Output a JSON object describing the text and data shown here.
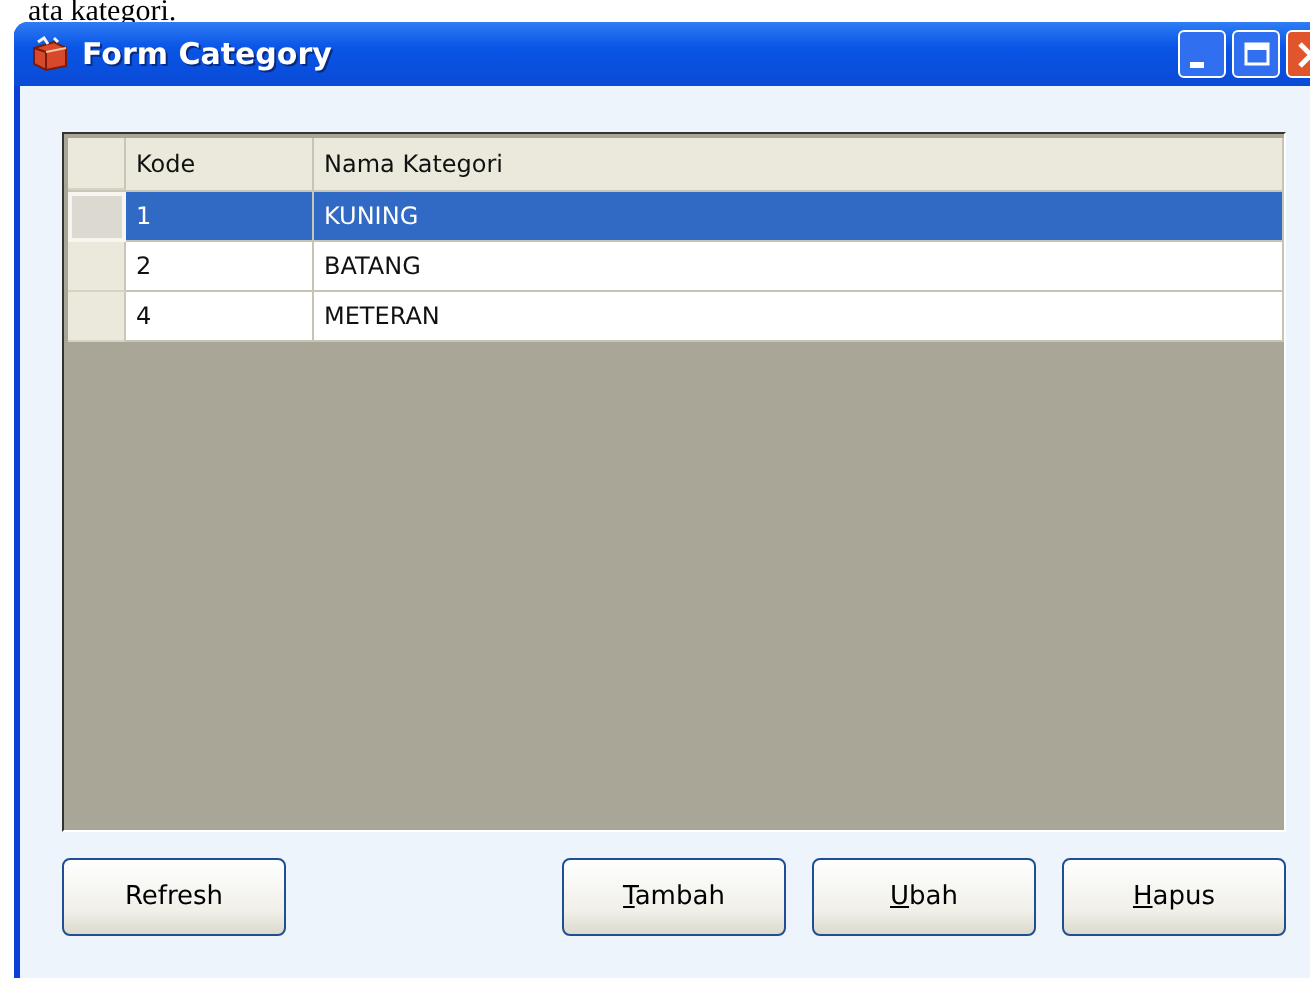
{
  "document_text": "ata kategori.",
  "window": {
    "title": "Form Category"
  },
  "table": {
    "columns": [
      "Kode",
      "Nama Kategori"
    ],
    "rows": [
      {
        "cells": [
          "1",
          "KUNING"
        ],
        "selected": true
      },
      {
        "cells": [
          "2",
          "BATANG"
        ],
        "selected": false
      },
      {
        "cells": [
          "4",
          "METERAN"
        ],
        "selected": false
      }
    ]
  },
  "left_buttons": [
    {
      "label": "Refresh",
      "first_letter_underlined": false
    }
  ],
  "right_buttons": [
    {
      "label": "Tambah",
      "first_letter_underlined": true
    },
    {
      "label": "Ubah",
      "first_letter_underlined": true
    },
    {
      "label": "Hapus",
      "first_letter_underlined": true
    }
  ]
}
